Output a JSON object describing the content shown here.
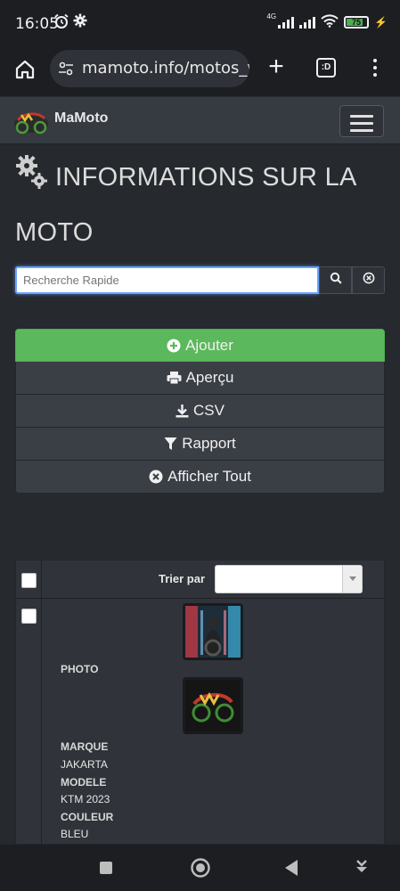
{
  "status_bar": {
    "time": "16:05",
    "network": "4G",
    "battery_level": "75"
  },
  "browser": {
    "url": "mamoto.info/motos_v",
    "tab_switcher_label": ":D"
  },
  "navbar": {
    "brand": "MaMoto"
  },
  "page": {
    "title": "INFORMATIONS SUR LA MOTO"
  },
  "search": {
    "placeholder": "Recherche Rapide"
  },
  "actions": {
    "add_label": "Ajouter",
    "preview_label": "Aperçu",
    "csv_label": "CSV",
    "report_label": "Rapport",
    "show_all_label": "Afficher Tout"
  },
  "table": {
    "sort_label": "Trier par",
    "sort_value": "",
    "row": {
      "photo_label": "PHOTO",
      "brand_label": "MARQUE",
      "brand_value": "JAKARTA",
      "model_label": "MODELE",
      "model_value": "KTM 2023",
      "color_label": "COULEUR",
      "color_value": "BLEU"
    }
  },
  "colors": {
    "add_button": "#5cb85c",
    "background": "#26292e",
    "navbar": "#363a41",
    "search_focus": "#66a3ff"
  },
  "icons": [
    "alarm-icon",
    "settings-icon",
    "signal-icon",
    "wifi-icon",
    "battery-icon",
    "home-icon",
    "site-settings-icon",
    "plus-icon",
    "tabs-icon",
    "more-vert-icon",
    "hamburger-icon",
    "gears-icon",
    "search-icon",
    "clear-icon",
    "plus-circle-icon",
    "print-icon",
    "download-icon",
    "filter-icon",
    "times-circle-icon",
    "square-nav-icon",
    "circle-nav-icon",
    "back-triangle-icon",
    "download-nav-icon"
  ]
}
